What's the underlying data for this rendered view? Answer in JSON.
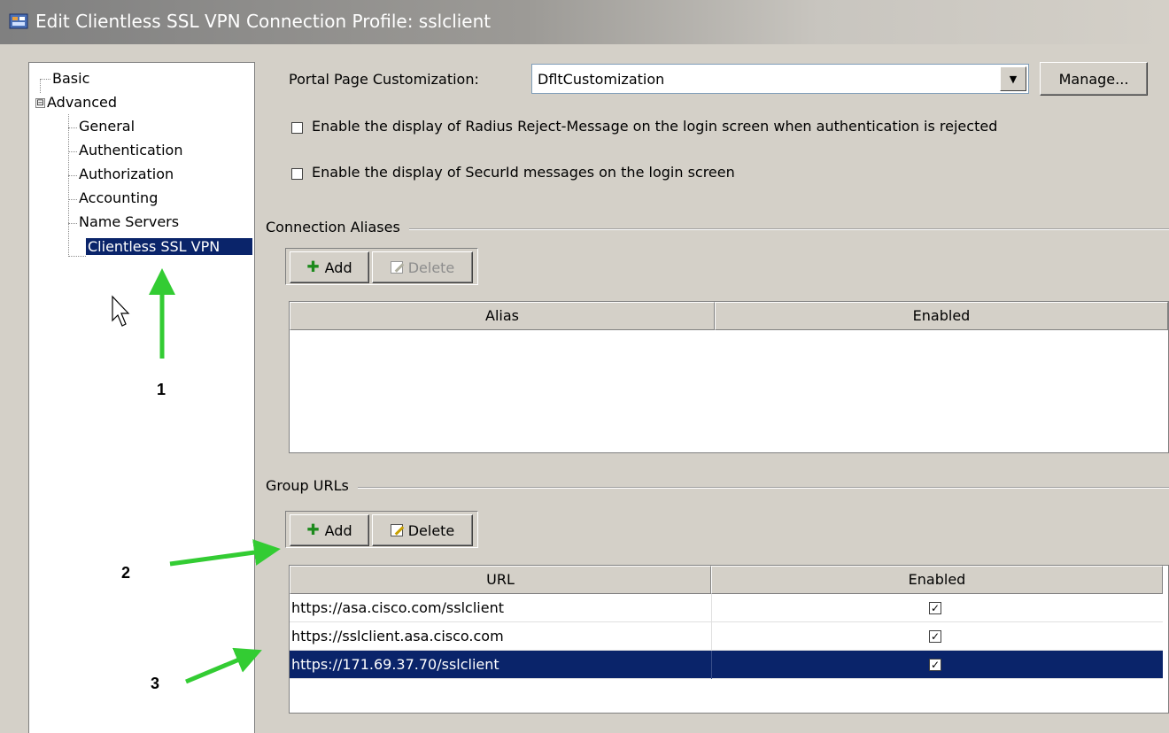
{
  "window": {
    "title": "Edit Clientless SSL VPN Connection Profile: sslclient",
    "icon": "app-window-icon"
  },
  "tree": {
    "items": [
      {
        "label": "Basic"
      },
      {
        "label": "Advanced",
        "expander": "⊟"
      },
      {
        "label": "General"
      },
      {
        "label": "Authentication"
      },
      {
        "label": "Authorization"
      },
      {
        "label": "Accounting"
      },
      {
        "label": "Name Servers"
      },
      {
        "label": "Clientless SSL VPN",
        "selected": true
      }
    ]
  },
  "portal": {
    "label": "Portal Page Customization:",
    "value": "DfltCustomization",
    "manage_label": "Manage..."
  },
  "options": {
    "radius_reject_label": "Enable the display of Radius Reject-Message on the login screen when authentication is rejected",
    "radius_reject_checked": false,
    "securid_label": "Enable the display of SecurId messages on the login screen",
    "securid_checked": false
  },
  "connection_aliases": {
    "title": "Connection Aliases",
    "add_label": "Add",
    "delete_label": "Delete",
    "columns": [
      "Alias",
      "Enabled"
    ],
    "rows": []
  },
  "group_urls": {
    "title": "Group URLs",
    "add_label": "Add",
    "delete_label": "Delete",
    "columns": [
      "URL",
      "Enabled"
    ],
    "rows": [
      {
        "url": "https://asa.cisco.com/sslclient",
        "enabled": true,
        "selected": false
      },
      {
        "url": "https://sslclient.asa.cisco.com",
        "enabled": true,
        "selected": false
      },
      {
        "url": "https://171.69.37.70/sslclient",
        "enabled": true,
        "selected": true
      }
    ]
  },
  "annotations": {
    "label_1": "1",
    "label_2": "2",
    "label_3": "3",
    "arrow_color": "#33cc33"
  },
  "colors": {
    "selection": "#0a246a",
    "dialog_background": "#d4d0c8"
  }
}
